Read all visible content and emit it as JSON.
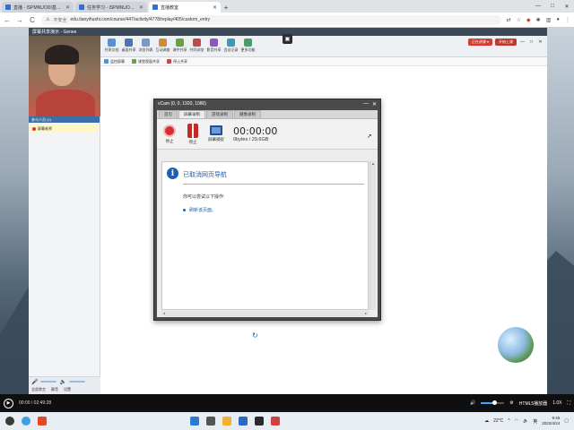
{
  "browser": {
    "tabs": [
      {
        "label": "直播 - ISPMNUODI基防护士认...",
        "active": false
      },
      {
        "label": "任务学习 - ISPMNUODI基防...",
        "active": false
      },
      {
        "label": "直播教室",
        "active": true
      }
    ],
    "new_tab": "+",
    "window_controls": [
      "—",
      "□",
      "✕"
    ],
    "nav": {
      "back": "←",
      "forward": "→",
      "reload": "C"
    },
    "address": {
      "security_label": "不安全",
      "url": "edu.tianyihushi.com/course/447/activity/4778/replay/405/custom_entry"
    }
  },
  "genee": {
    "title": "屏幕共享演示 - Genee",
    "toolbar": [
      {
        "label": "共享文档",
        "color": "#5a8fd0"
      },
      {
        "label": "桌面共享",
        "color": "#4a74b8"
      },
      {
        "label": "浏览列表",
        "color": "#7a9ac4"
      },
      {
        "label": "互动调查",
        "color": "#d08a3a"
      },
      {
        "label": "课件共享",
        "color": "#6aa04a"
      },
      {
        "label": "共同浏览",
        "color": "#c04a4a"
      },
      {
        "label": "影音共享",
        "color": "#8a5ab8"
      },
      {
        "label": "会议记录",
        "color": "#3a9ab8"
      },
      {
        "label": "更多功能",
        "color": "#4a9a6a"
      }
    ],
    "subbar": [
      "监控屏幕",
      "课堂视窗共享",
      "停止共享"
    ],
    "center_icon": "▣",
    "top_buttons": [
      {
        "label": "正在讲课 ▾"
      },
      {
        "label": "开始上课"
      }
    ],
    "top_controls": [
      "—",
      "□",
      "✕"
    ],
    "left_panel": {
      "header": "参与人员 (1)",
      "participants": [
        {
          "name": "屏幕老师"
        }
      ],
      "bottom_buttons": [
        "全部禁言",
        "静音",
        "设置"
      ]
    }
  },
  "vcam": {
    "title": "vCam (0, 0, 1920, 1080)",
    "controls": [
      "—",
      "✕"
    ],
    "tabs": [
      {
        "label": "首页",
        "active": false
      },
      {
        "label": "屏幕录制",
        "active": true
      },
      {
        "label": "游戏录制",
        "active": false
      },
      {
        "label": "摄像录制",
        "active": false
      }
    ],
    "buttons": [
      {
        "label": "停止"
      },
      {
        "label": "停止"
      },
      {
        "label": "屏幕捕捉"
      }
    ],
    "timer": "00:00:00",
    "size": "0bytes / 29.6GB",
    "heading": "已取消网页导航",
    "description": "你可以尝试以下操作:",
    "link": "刷新该页面。"
  },
  "player": {
    "time": "00:00 / 02:49:28",
    "quality": "HTML5播放器",
    "speed": "1.0X",
    "volume_fraction": 0.55
  },
  "taskbar": {
    "weather": "22°C",
    "lang": "英",
    "time": "9:46",
    "date": "2022/4/24"
  }
}
